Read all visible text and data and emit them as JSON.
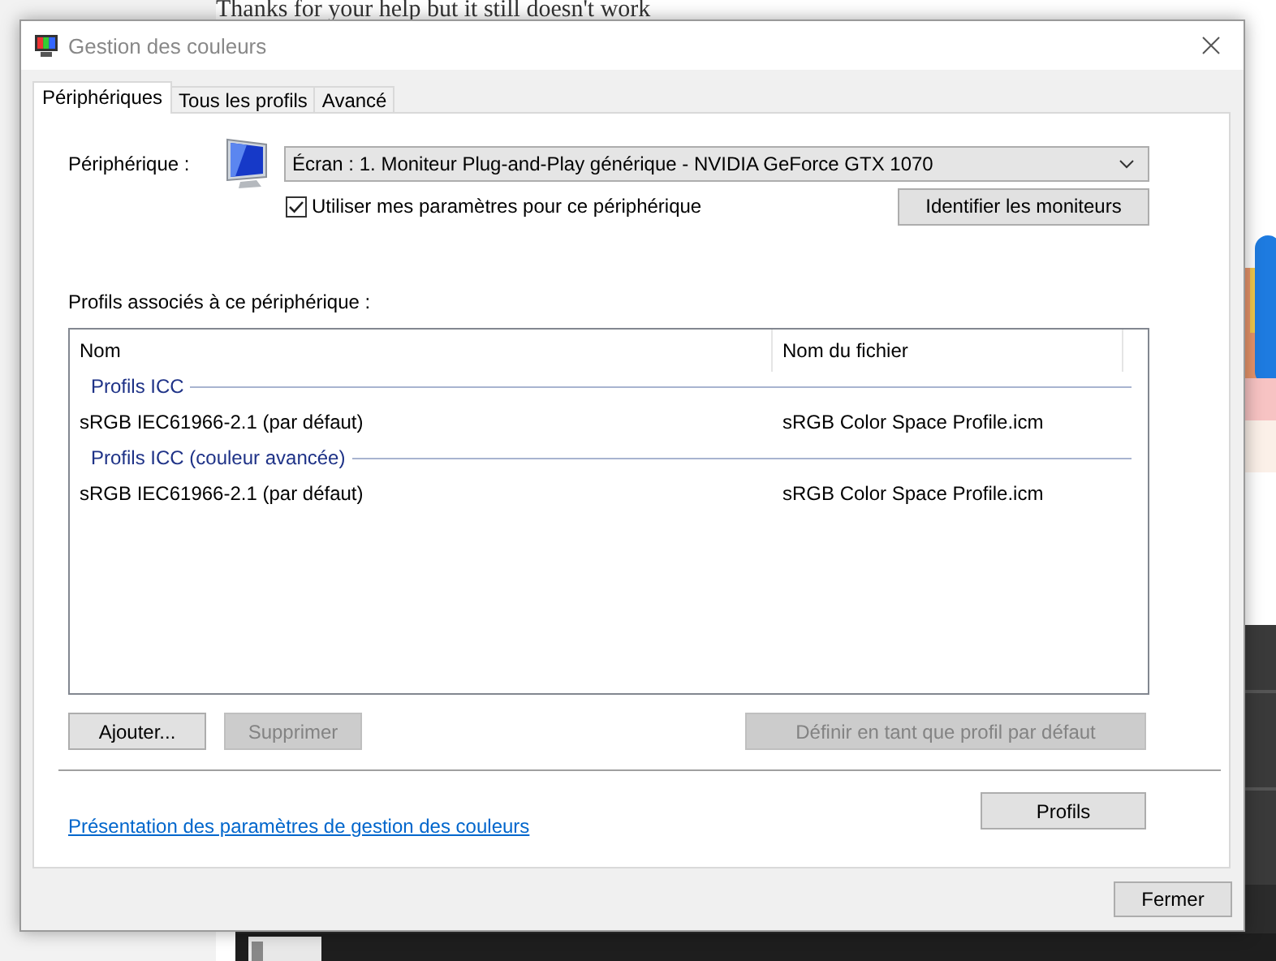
{
  "background": {
    "heading": "Thanks for your help but it still doesn't work"
  },
  "window": {
    "title": "Gestion des couleurs"
  },
  "tabs": [
    {
      "label": "Périphériques",
      "selected": true
    },
    {
      "label": "Tous les profils",
      "selected": false
    },
    {
      "label": "Avancé",
      "selected": false
    }
  ],
  "device": {
    "label": "Périphérique :",
    "value": "Écran : 1. Moniteur Plug-and-Play générique - NVIDIA GeForce GTX 1070",
    "use_my_settings": {
      "label": "Utiliser mes paramètres pour ce périphérique",
      "checked": true
    },
    "identify_button": "Identifier les moniteurs"
  },
  "profiles": {
    "label": "Profils associés à ce périphérique :",
    "columns": [
      "Nom",
      "Nom du fichier"
    ],
    "groups": [
      {
        "title": "Profils ICC",
        "rows": [
          {
            "name": "sRGB IEC61966-2.1 (par défaut)",
            "file": "sRGB Color Space Profile.icm"
          }
        ]
      },
      {
        "title": "Profils ICC (couleur avancée)",
        "rows": [
          {
            "name": "sRGB IEC61966-2.1 (par défaut)",
            "file": "sRGB Color Space Profile.icm"
          }
        ]
      }
    ]
  },
  "buttons": [
    {
      "label": "Ajouter...",
      "disabled": false
    },
    {
      "label": "Supprimer",
      "disabled": true
    },
    {
      "label": "Définir en tant que profil par défaut",
      "disabled": true
    }
  ],
  "link": "Présentation des paramètres de gestion des couleurs",
  "profiles_button": "Profils",
  "close_button": "Fermer"
}
